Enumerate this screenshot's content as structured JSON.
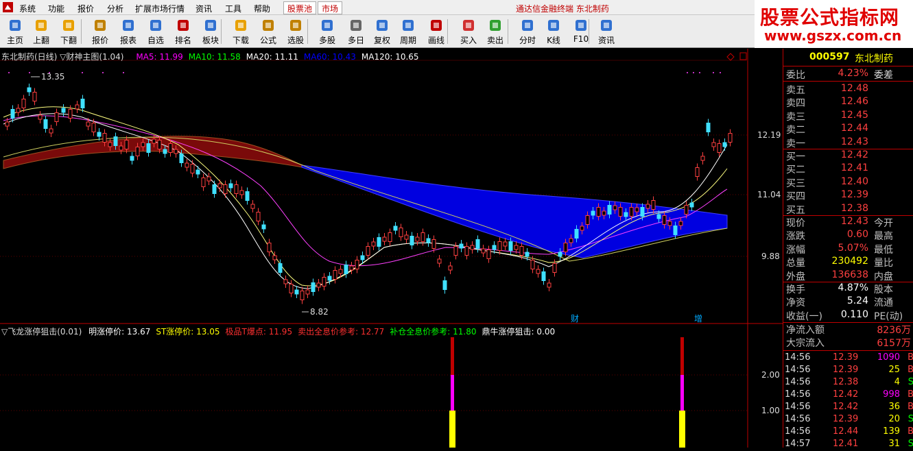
{
  "menubar": {
    "items": [
      "系统",
      "功能",
      "报价",
      "分析",
      "扩展市场行情",
      "资讯",
      "工具",
      "帮助"
    ],
    "highlight_items": [
      "股票池",
      "市场"
    ],
    "title": "通达信金融终端  东北制药"
  },
  "toolbar": {
    "buttons": [
      {
        "label": "主页",
        "icon": "home-icon"
      },
      {
        "label": "上翻",
        "icon": "arrow-up-icon"
      },
      {
        "label": "下翻",
        "icon": "arrow-down-icon"
      },
      {
        "label": "报价",
        "icon": "quote-icon"
      },
      {
        "label": "报表",
        "icon": "report-icon"
      },
      {
        "label": "自选",
        "icon": "watchlist-icon"
      },
      {
        "label": "排名",
        "icon": "ranking-icon"
      },
      {
        "label": "板块",
        "icon": "sector-icon"
      },
      {
        "label": "下载",
        "icon": "download-icon"
      },
      {
        "label": "公式",
        "icon": "formula-icon"
      },
      {
        "label": "选股",
        "icon": "stock-picker-icon"
      },
      {
        "label": "多股",
        "icon": "multi-stock-icon"
      },
      {
        "label": "多日",
        "icon": "multi-day-icon"
      },
      {
        "label": "复权",
        "icon": "adjust-icon"
      },
      {
        "label": "周期",
        "icon": "period-icon"
      },
      {
        "label": "画线",
        "icon": "draw-line-icon"
      },
      {
        "label": "买入",
        "icon": "buy-icon"
      },
      {
        "label": "卖出",
        "icon": "sell-icon"
      },
      {
        "label": "分时",
        "icon": "intraday-icon"
      },
      {
        "label": "K线",
        "icon": "kline-icon"
      },
      {
        "label": "F10",
        "icon": "f10-icon"
      },
      {
        "label": "资讯",
        "icon": "news-icon"
      }
    ]
  },
  "watermark": {
    "line1": "股票公式指标网",
    "line2": "www.gszx.com.cn"
  },
  "chart": {
    "title": "东北制药(日线) ▽财神主图(1.04)",
    "ma": [
      {
        "label": "MA5: 11.99",
        "color": "#ff00ff"
      },
      {
        "label": "MA10: 11.58",
        "color": "#00ff00"
      },
      {
        "label": "MA20: 11.11",
        "color": "#ffffff"
      },
      {
        "label": "MA60: 10.43",
        "color": "#0000ff"
      },
      {
        "label": "MA120: 10.65",
        "color": "#ffffff"
      }
    ],
    "high_label": "13.35",
    "low_label": "8.82",
    "price_axis": [
      "12.19",
      "11.04",
      "9.88"
    ],
    "markers": [
      "财",
      "增"
    ]
  },
  "indicator": {
    "title": "▽飞龙涨停狙击(0.01)",
    "fields": [
      {
        "label": "明涨停价: 13.67",
        "color": "#ffffff"
      },
      {
        "label": "ST涨停价: 13.05",
        "color": "#ffff00"
      },
      {
        "label": "极品T爆点: 11.95",
        "color": "#ff3030"
      },
      {
        "label": "卖出全息价参考: 12.77",
        "color": "#ff3030"
      },
      {
        "label": "补仓全息价参考: 11.80",
        "color": "#00ff00"
      },
      {
        "label": "鼎牛涨停狙击: 0.00",
        "color": "#ffffff"
      }
    ],
    "axis": [
      "2.00",
      "1.00"
    ]
  },
  "quote": {
    "code": "000597",
    "name": "东北制药",
    "weibi_label": "委比",
    "weibi": "4.23%",
    "weicha_label": "委差",
    "asks": [
      {
        "label": "卖五",
        "price": "12.48"
      },
      {
        "label": "卖四",
        "price": "12.46"
      },
      {
        "label": "卖三",
        "price": "12.45"
      },
      {
        "label": "卖二",
        "price": "12.44"
      },
      {
        "label": "卖一",
        "price": "12.43"
      }
    ],
    "bids": [
      {
        "label": "买一",
        "price": "12.42"
      },
      {
        "label": "买二",
        "price": "12.41"
      },
      {
        "label": "买三",
        "price": "12.40"
      },
      {
        "label": "买四",
        "price": "12.39"
      },
      {
        "label": "买五",
        "price": "12.38"
      }
    ],
    "stats": [
      {
        "label": "现价",
        "value": "12.43",
        "color": "#ff4040",
        "label2": "今开"
      },
      {
        "label": "涨跌",
        "value": "0.60",
        "color": "#ff4040",
        "label2": "最高"
      },
      {
        "label": "涨幅",
        "value": "5.07%",
        "color": "#ff4040",
        "label2": "最低"
      },
      {
        "label": "总量",
        "value": "230492",
        "color": "#ffff00",
        "label2": "量比"
      },
      {
        "label": "外盘",
        "value": "136638",
        "color": "#ff4040",
        "label2": "内盘"
      }
    ],
    "stats2": [
      {
        "label": "换手",
        "value": "4.87%",
        "color": "#ffffff",
        "label2": "股本"
      },
      {
        "label": "净资",
        "value": "5.24",
        "color": "#ffffff",
        "label2": "流通"
      },
      {
        "label": "收益(一)",
        "value": "0.110",
        "color": "#ffffff",
        "label2": "PE(动)"
      }
    ],
    "flow": [
      {
        "label": "净流入额",
        "value": "8236万"
      },
      {
        "label": "大宗流入",
        "value": "6157万"
      }
    ],
    "ticks": [
      {
        "time": "14:56",
        "price": "12.39",
        "vol": "1090",
        "vcolor": "#ff00ff",
        "dir": "B",
        "dcolor": "#ff4040"
      },
      {
        "time": "14:56",
        "price": "12.39",
        "vol": "25",
        "vcolor": "#ffff00",
        "dir": "B",
        "dcolor": "#ff4040"
      },
      {
        "time": "14:56",
        "price": "12.38",
        "vol": "4",
        "vcolor": "#ffff00",
        "dir": "S",
        "dcolor": "#00ff00"
      },
      {
        "time": "14:56",
        "price": "12.42",
        "vol": "998",
        "vcolor": "#ff00ff",
        "dir": "B",
        "dcolor": "#ff4040"
      },
      {
        "time": "14:56",
        "price": "12.42",
        "vol": "36",
        "vcolor": "#ffff00",
        "dir": "B",
        "dcolor": "#ff4040"
      },
      {
        "time": "14:56",
        "price": "12.39",
        "vol": "20",
        "vcolor": "#ffff00",
        "dir": "S",
        "dcolor": "#00ff00"
      },
      {
        "time": "14:56",
        "price": "12.44",
        "vol": "139",
        "vcolor": "#ffff00",
        "dir": "B",
        "dcolor": "#ff4040"
      },
      {
        "time": "14:57",
        "price": "12.41",
        "vol": "31",
        "vcolor": "#ffff00",
        "dir": "S",
        "dcolor": "#00ff00"
      }
    ]
  }
}
